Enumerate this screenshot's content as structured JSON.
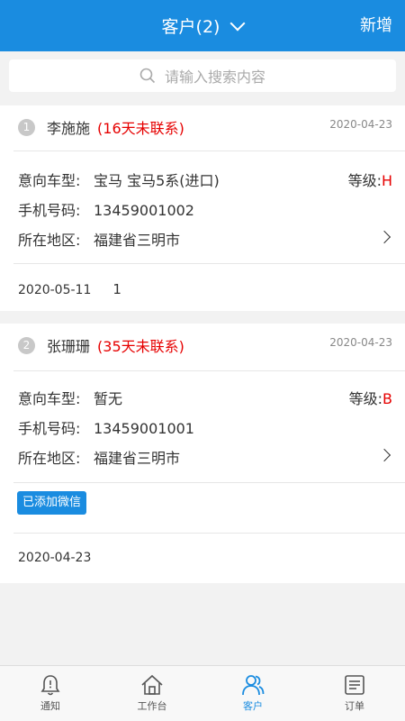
{
  "header": {
    "title": "客户(2)",
    "new_label": "新增"
  },
  "search": {
    "placeholder": "请输入搜索内容"
  },
  "labels": {
    "car_model": "意向车型:",
    "phone": "手机号码:",
    "region": "所在地区:",
    "grade": "等级:"
  },
  "customers": [
    {
      "index": "1",
      "name": "李施施",
      "overdue": "(16天未联系)",
      "date": "2020-04-23",
      "car_model": "宝马 宝马5系(进口)",
      "grade": "H",
      "phone": "13459001002",
      "region": "福建省三明市",
      "footer_date": "2020-05-11",
      "footer_note": "1"
    },
    {
      "index": "2",
      "name": "张珊珊",
      "overdue": "(35天未联系)",
      "date": "2020-04-23",
      "car_model": "暂无",
      "grade": "B",
      "phone": "13459001001",
      "region": "福建省三明市",
      "tag": "已添加微信",
      "footer_date": "2020-04-23"
    }
  ],
  "tabbar": {
    "items": [
      {
        "label": "通知",
        "icon": "bell-icon"
      },
      {
        "label": "工作台",
        "icon": "home-icon"
      },
      {
        "label": "客户",
        "icon": "people-icon",
        "active": true
      },
      {
        "label": "订单",
        "icon": "document-icon"
      }
    ]
  },
  "colors": {
    "accent": "#1a8ce0",
    "alert": "#e60000"
  }
}
